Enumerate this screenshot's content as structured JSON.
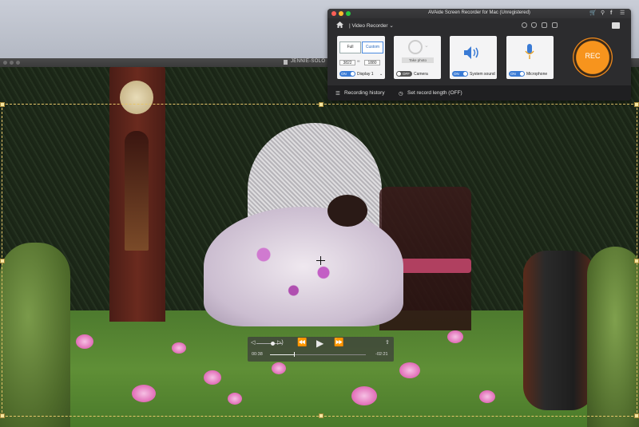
{
  "player": {
    "title": "JENNIE-SOLO",
    "controls": {
      "current_time": "00:38",
      "remaining_time": "-02:21",
      "progress": 0.25,
      "volume": 0.55
    }
  },
  "recorder": {
    "title": "AVAide Screen Recorder for Mac (Unregistered)",
    "mode": "Video Recorder",
    "display_card": {
      "full_label": "Full",
      "custom_label": "Custom",
      "width": "3822",
      "height": "1880",
      "toggle": "ON",
      "label": "Display 1"
    },
    "camera_card": {
      "take_photo": "Take photo",
      "toggle": "OFF",
      "label": "Camera"
    },
    "sound_card": {
      "toggle": "ON",
      "label": "System sound"
    },
    "mic_card": {
      "toggle": "ON",
      "label": "Microphone"
    },
    "rec_label": "REC",
    "bottom": {
      "history": "Recording history",
      "length": "Set record length (OFF)"
    }
  },
  "colors": {
    "accent_orange": "#f7941d",
    "toggle_on": "#3a7bd5",
    "selection": "#e7c66a"
  }
}
